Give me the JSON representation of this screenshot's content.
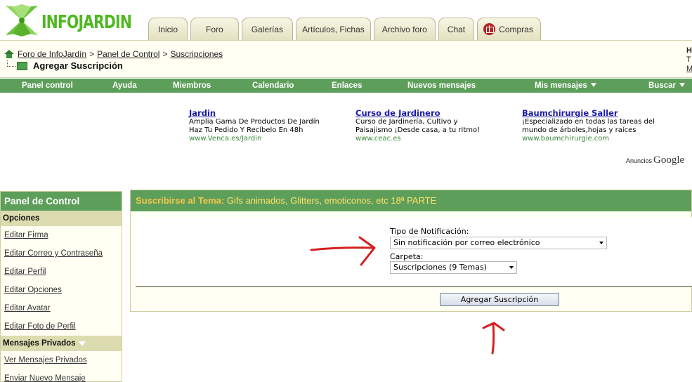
{
  "logo": {
    "text": "INFOJARDIN"
  },
  "tabs": [
    {
      "label": "Inicio"
    },
    {
      "label": "Foro"
    },
    {
      "label": "Galerías"
    },
    {
      "label": "Artículos, Fichas"
    },
    {
      "label": "Archivo foro"
    },
    {
      "label": "Chat"
    },
    {
      "label": "Compras",
      "icon": "gift-icon"
    }
  ],
  "breadcrumb": {
    "items": [
      "Foro de InfoJardín",
      "Panel de Control",
      "Suscripciones"
    ],
    "separator": ">",
    "title": "Agregar Suscripción"
  },
  "right_cut": {
    "line1": "H",
    "line2": "T",
    "line3": "M"
  },
  "nav": [
    {
      "label": "Panel control"
    },
    {
      "label": "Ayuda"
    },
    {
      "label": "Miembros"
    },
    {
      "label": "Calendario"
    },
    {
      "label": "Enlaces"
    },
    {
      "label": "Nuevos mensajes"
    },
    {
      "label": "Mis mensajes",
      "dropdown": true
    },
    {
      "label": "Buscar",
      "dropdown": true
    }
  ],
  "ads": [
    {
      "title": "Jardin",
      "line1": "Amplia Gama De Productos De Jardín",
      "line2": "Haz Tu Pedido Y Recíbelo En 48h",
      "url": "www.Venca.es/Jardin"
    },
    {
      "title": "Curso de Jardinero",
      "line1": "Curso de Jardinería, Cultivo y",
      "line2": "Paisajismo ¡Desde casa, a tu ritmo!",
      "url": "www.ceac.es"
    },
    {
      "title": "Baumchirurgie Saller",
      "line1": "¡Especializado en todas las tareas del",
      "line2": "mundo de árboles,hojas y raíces",
      "url": "www.baumchirurgie.com"
    }
  ],
  "ads_footer": {
    "label": "Anuncios",
    "brand": "Google"
  },
  "sidebar": {
    "title": "Panel de Control",
    "sections": [
      {
        "title": "Opciones",
        "links": [
          "Editar Firma",
          "Editar Correo y Contraseña",
          "Editar Perfil",
          "Editar Opciones",
          "Editar Avatar",
          "Editar Foto de Perfil"
        ]
      },
      {
        "title": "Mensajes Privados",
        "links": [
          "Ver Mensajes Privados",
          "Enviar Nuevo Mensaje"
        ]
      }
    ]
  },
  "main": {
    "heading_label": "Suscribirse al Tema:",
    "heading_value": "Gifs animados, Glitters, emoticonos, etc 18ª PARTE",
    "notif_label": "Tipo de Notificación:",
    "notif_value": "Sin notificación por correo electrónico",
    "folder_label": "Carpeta:",
    "folder_value": "Suscripciones (9 Temas)",
    "submit_label": "Agregar Suscripción"
  },
  "colors": {
    "green_bar": "#5d9f5a",
    "cream": "#fffff3",
    "link_blue": "#1a1aa6",
    "ad_url_green": "#3a8a3a",
    "heading_gold": "#f7c64a",
    "arrow_red": "#d42020",
    "logo_green": "#4fb821"
  }
}
